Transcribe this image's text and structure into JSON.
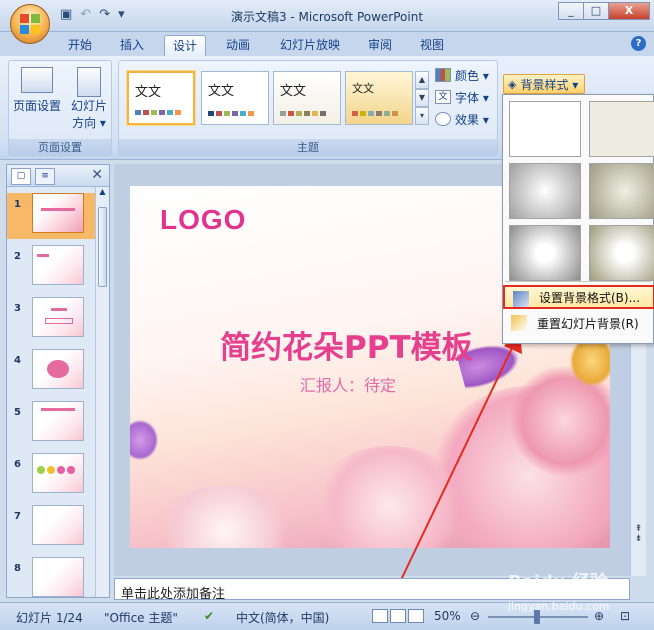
{
  "window": {
    "title": "演示文稿3 - Microsoft PowerPoint",
    "minimize": "_",
    "restore": "□",
    "close": "X"
  },
  "qat": {
    "undo": "↶",
    "redo": "↷",
    "customize": "▾"
  },
  "tabs": [
    {
      "label": "开始"
    },
    {
      "label": "插入"
    },
    {
      "label": "设计"
    },
    {
      "label": "动画"
    },
    {
      "label": "幻灯片放映"
    },
    {
      "label": "审阅"
    },
    {
      "label": "视图"
    }
  ],
  "help": "?",
  "ribbon": {
    "page_setup_group": {
      "label": "页面设置",
      "page_setup": "页面设置",
      "orientation_1": "幻灯片",
      "orientation_2": "方向 ▾"
    },
    "theme_group": {
      "label": "主题",
      "themes": [
        {
          "text": "文文"
        },
        {
          "text": "文文"
        },
        {
          "text": "文文"
        },
        {
          "text": "文文"
        }
      ],
      "colors": "颜色 ▾",
      "fonts": "字体 ▾",
      "effects": "效果 ▾"
    },
    "background_styles": "背景样式 ▾"
  },
  "dropdown": {
    "format_background": "设置背景格式(B)...",
    "reset_background": "重置幻灯片背景(R)"
  },
  "slides_panel": {
    "numbers": [
      "1",
      "2",
      "3",
      "4",
      "5",
      "6",
      "7",
      "8"
    ]
  },
  "slide": {
    "logo": "LOGO",
    "title": "简约花朵PPT模板",
    "subtitle": "汇报人：待定"
  },
  "notes_placeholder": "单击此处添加备注",
  "status": {
    "slide_count": "幻灯片 1/24",
    "theme": "\"Office 主题\"",
    "language": "中文(简体，中国)",
    "zoom": "50%"
  },
  "watermark": {
    "brand": "Baidu 经验",
    "url": "jingyan.baidu.com"
  },
  "colors": {
    "accent": "#e63f8e",
    "highlight": "#e8291e"
  }
}
